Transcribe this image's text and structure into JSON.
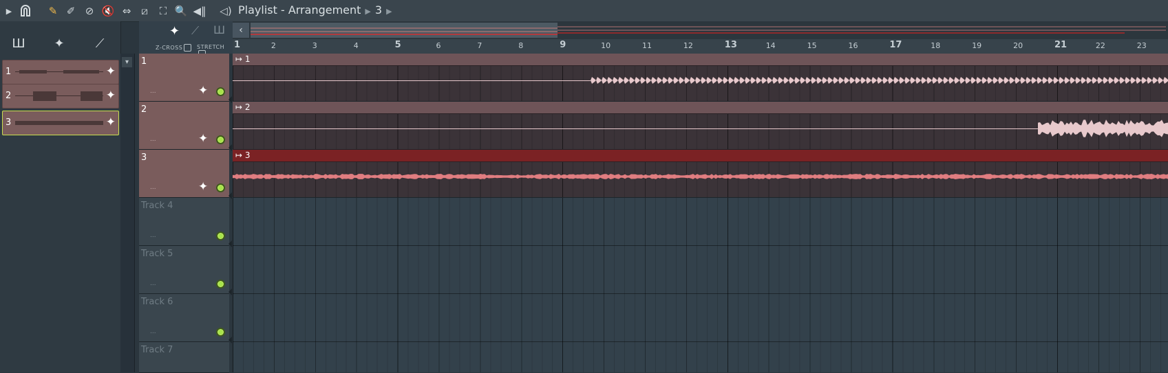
{
  "toolbar": {
    "title": "Playlist - Arrangement",
    "pattern": "3",
    "icons": [
      "play-arrow",
      "magnet",
      "draw-pencil",
      "paint",
      "mute-circle",
      "mute-speaker",
      "slip",
      "slice",
      "select",
      "zoom",
      "playback",
      "speaker"
    ]
  },
  "browser": {
    "mode_icons": [
      "piano-roll",
      "audio-clip",
      "automation"
    ],
    "clips": [
      {
        "label": "1",
        "selected": false
      },
      {
        "label": "2",
        "selected": false
      },
      {
        "label": "3",
        "selected": true
      }
    ]
  },
  "header_options": {
    "zcross_label": "Z-CROSS",
    "stretch_label": "STRETCH"
  },
  "ruler": {
    "bars": [
      "1",
      "2",
      "3",
      "4",
      "5",
      "6",
      "7",
      "8",
      "9",
      "10",
      "11",
      "12",
      "13",
      "14",
      "15",
      "16",
      "17",
      "18",
      "19",
      "20",
      "21",
      "22",
      "23"
    ]
  },
  "tracks": [
    {
      "name": "1",
      "dots": "...",
      "used": true,
      "clip_label": "1",
      "clip_selected": false
    },
    {
      "name": "2",
      "dots": "...",
      "used": true,
      "clip_label": "2",
      "clip_selected": false
    },
    {
      "name": "3",
      "dots": "...",
      "used": true,
      "clip_label": "3",
      "clip_selected": true
    },
    {
      "name": "Track 4",
      "dots": "...",
      "used": false
    },
    {
      "name": "Track 5",
      "dots": "...",
      "used": false
    },
    {
      "name": "Track 6",
      "dots": "...",
      "used": false
    },
    {
      "name": "Track 7",
      "dots": "...",
      "used": false
    }
  ],
  "colors": {
    "clip": "#7a5c5c",
    "selected_clip": "#7b2224",
    "waveform_pink": "#e8c9cc",
    "waveform_red": "#e07d80",
    "led_green": "#a7e34a",
    "selected_outline": "#c9df4f"
  }
}
